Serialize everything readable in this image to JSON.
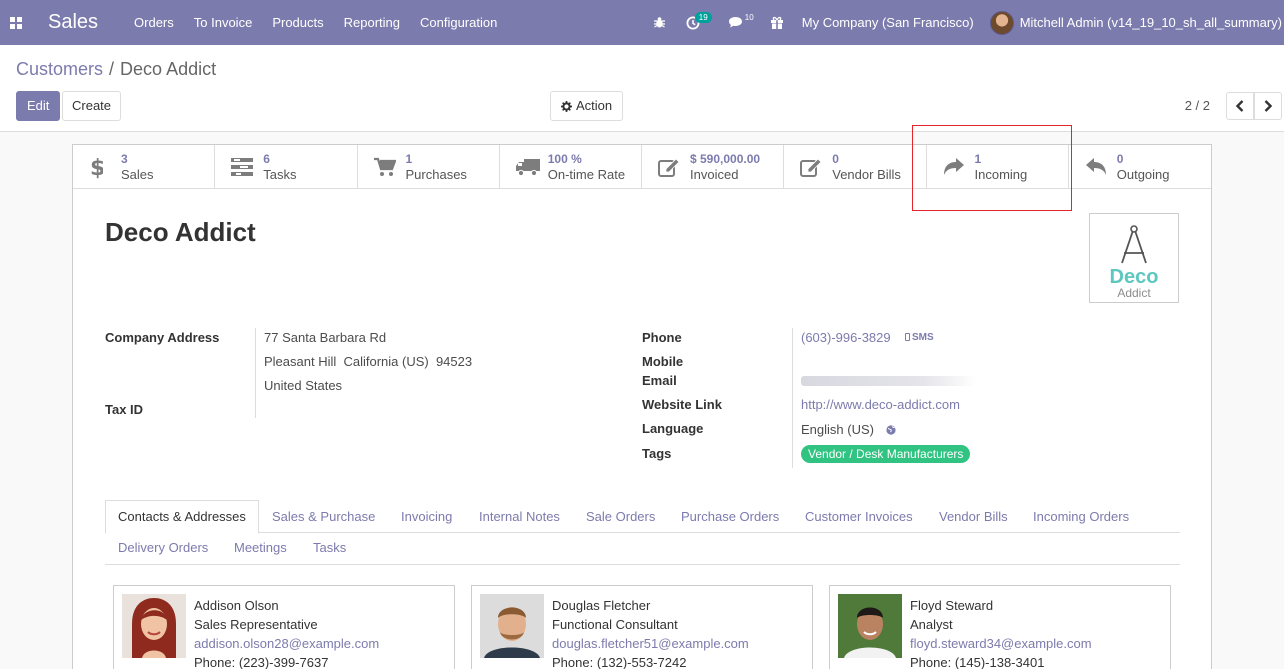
{
  "navbar": {
    "app_name": "Sales",
    "menu": [
      "Orders",
      "To Invoice",
      "Products",
      "Reporting",
      "Configuration"
    ],
    "activity_badge": "19",
    "messages_badge": "10",
    "company": "My Company (San Francisco)",
    "user": "Mitchell Admin (v14_19_10_sh_all_summary)"
  },
  "breadcrumb": {
    "parent": "Customers",
    "separator": "/",
    "current": "Deco Addict"
  },
  "buttons": {
    "edit": "Edit",
    "create": "Create",
    "action": "Action"
  },
  "pager": {
    "value": "2 / 2"
  },
  "smart_buttons": [
    {
      "value": "3",
      "label": "Sales",
      "icon": "dollar-icon"
    },
    {
      "value": "6",
      "label": "Tasks",
      "icon": "tasks-icon"
    },
    {
      "value": "1",
      "label": "Purchases",
      "icon": "cart-icon"
    },
    {
      "value": "100 %",
      "label": "On-time Rate",
      "icon": "truck-icon"
    },
    {
      "value": "$ 590,000.00",
      "label": "Invoiced",
      "icon": "pencil-square-icon"
    },
    {
      "value": "0",
      "label": "Vendor Bills",
      "icon": "pencil-square-icon"
    },
    {
      "value": "1",
      "label": "Incoming",
      "icon": "share-icon"
    },
    {
      "value": "0",
      "label": "Outgoing",
      "icon": "reply-icon"
    }
  ],
  "partner": {
    "name": "Deco Addict",
    "logo_word": "Deco",
    "logo_sub": "Addict"
  },
  "fields": {
    "company_address_label": "Company Address",
    "address_line1": "77 Santa Barbara Rd",
    "address_line2": "Pleasant Hill  California (US)  94523",
    "address_line3": "United States",
    "tax_id_label": "Tax ID",
    "phone_label": "Phone",
    "phone": "(603)-996-3829",
    "sms": "SMS",
    "mobile_label": "Mobile",
    "email_label": "Email",
    "website_label": "Website Link",
    "website": "http://www.deco-addict.com",
    "language_label": "Language",
    "language": "English (US)",
    "tags_label": "Tags",
    "tag": "Vendor / Desk Manufacturers"
  },
  "tabs": [
    "Contacts & Addresses",
    "Sales & Purchase",
    "Invoicing",
    "Internal Notes",
    "Sale Orders",
    "Purchase Orders",
    "Customer Invoices",
    "Vendor Bills",
    "Incoming Orders",
    "Delivery Orders",
    "Meetings",
    "Tasks"
  ],
  "contacts": [
    {
      "name": "Addison Olson",
      "function": "Sales Representative",
      "email": "addison.olson28@example.com",
      "phone": "Phone: (223)-399-7637"
    },
    {
      "name": "Douglas Fletcher",
      "function": "Functional Consultant",
      "email": "douglas.fletcher51@example.com",
      "phone": "Phone: (132)-553-7242"
    },
    {
      "name": "Floyd Steward",
      "function": "Analyst",
      "email": "floyd.steward34@example.com",
      "phone": "Phone: (145)-138-3401"
    }
  ],
  "colors": {
    "primary": "#7c7bad",
    "tag": "#30c381",
    "highlight": "#e3242b"
  }
}
